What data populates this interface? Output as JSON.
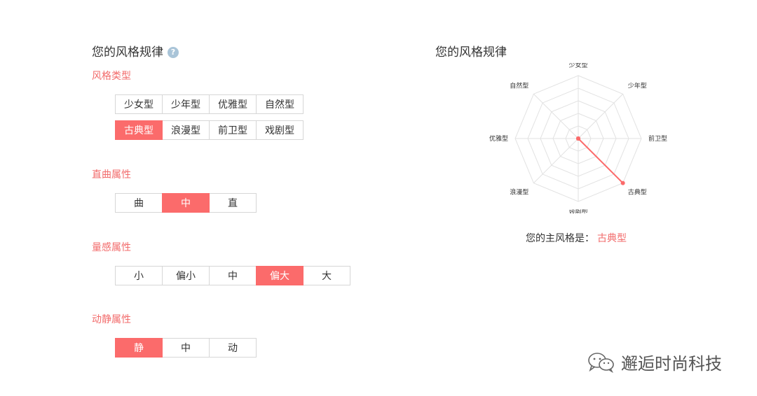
{
  "left_title": "您的风格规律",
  "help_icon_glyph": "?",
  "sections": [
    {
      "label": "风格类型",
      "rows": [
        [
          "少女型",
          "少年型",
          "优雅型",
          "自然型"
        ],
        [
          "古典型",
          "浪漫型",
          "前卫型",
          "戏剧型"
        ]
      ],
      "selected": "古典型"
    },
    {
      "label": "直曲属性",
      "rows": [
        [
          "曲",
          "中",
          "直"
        ]
      ],
      "selected": "中"
    },
    {
      "label": "量感属性",
      "rows": [
        [
          "小",
          "偏小",
          "中",
          "偏大",
          "大"
        ]
      ],
      "selected": "偏大"
    },
    {
      "label": "动静属性",
      "rows": [
        [
          "静",
          "中",
          "动"
        ]
      ],
      "selected": "静"
    }
  ],
  "right_title": "您的风格规律",
  "radar": {
    "axes": [
      "少女型",
      "少年型",
      "前卫型",
      "古典型",
      "戏剧型",
      "浪漫型",
      "优雅型",
      "自然型"
    ],
    "levels": 5,
    "max": 5,
    "values": [
      0,
      0,
      0,
      5,
      0,
      0,
      0,
      0
    ],
    "line_color": "#fb6b6b",
    "grid_color": "#e2e2e2"
  },
  "main_style": {
    "label": "您的主风格是：",
    "value": "古典型"
  },
  "watermark": {
    "text": "邂逅时尚科技",
    "icon": "wechat-icon"
  },
  "colors": {
    "accent": "#fb6b6b",
    "label": "#f26b6b",
    "border": "#d6d6d6"
  }
}
